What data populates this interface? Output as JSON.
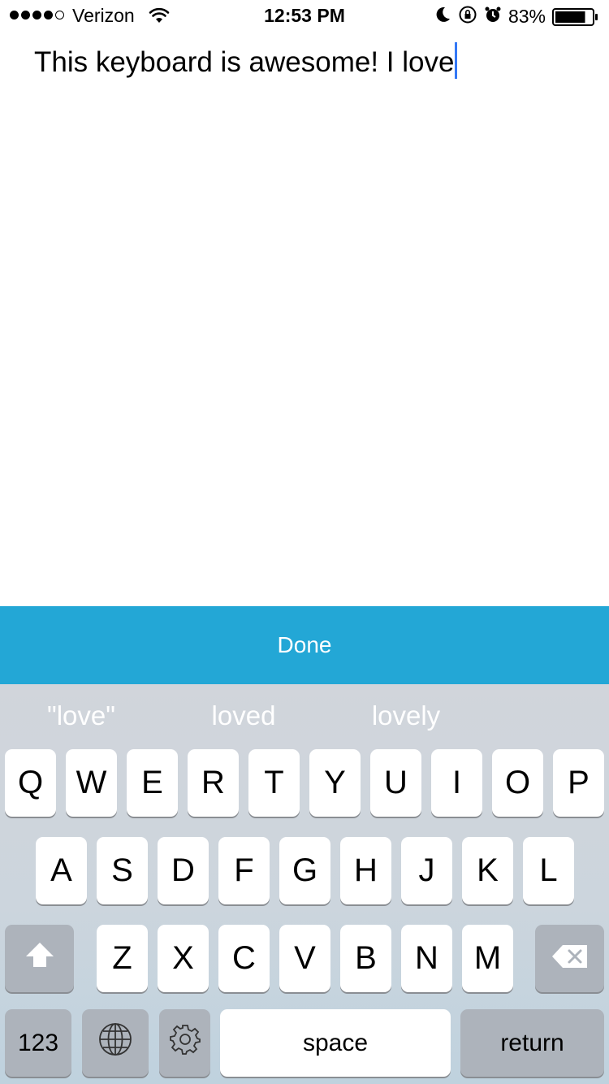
{
  "status_bar": {
    "carrier": "Verizon",
    "time": "12:53 PM",
    "battery_percent": "83%",
    "battery_level": 0.83,
    "signal_bars_filled": 4,
    "signal_bars_total": 5,
    "icons": [
      "wifi-icon",
      "moon-icon",
      "rotation-lock-icon",
      "alarm-icon",
      "battery-icon"
    ]
  },
  "editor": {
    "text": "This keyboard is awesome! I love"
  },
  "toolbar": {
    "done_label": "Done",
    "color": "#23a7d6"
  },
  "keyboard": {
    "suggestions": [
      "\"love\"",
      "loved",
      "lovely"
    ],
    "row1": [
      "Q",
      "W",
      "E",
      "R",
      "T",
      "Y",
      "U",
      "I",
      "O",
      "P"
    ],
    "row2": [
      "A",
      "S",
      "D",
      "F",
      "G",
      "H",
      "J",
      "K",
      "L"
    ],
    "row3": [
      "Z",
      "X",
      "C",
      "V",
      "B",
      "N",
      "M"
    ],
    "numbers_label": "123",
    "space_label": "space",
    "return_label": "return",
    "icons": [
      "shift-icon",
      "backspace-icon",
      "globe-icon",
      "gear-icon"
    ]
  }
}
